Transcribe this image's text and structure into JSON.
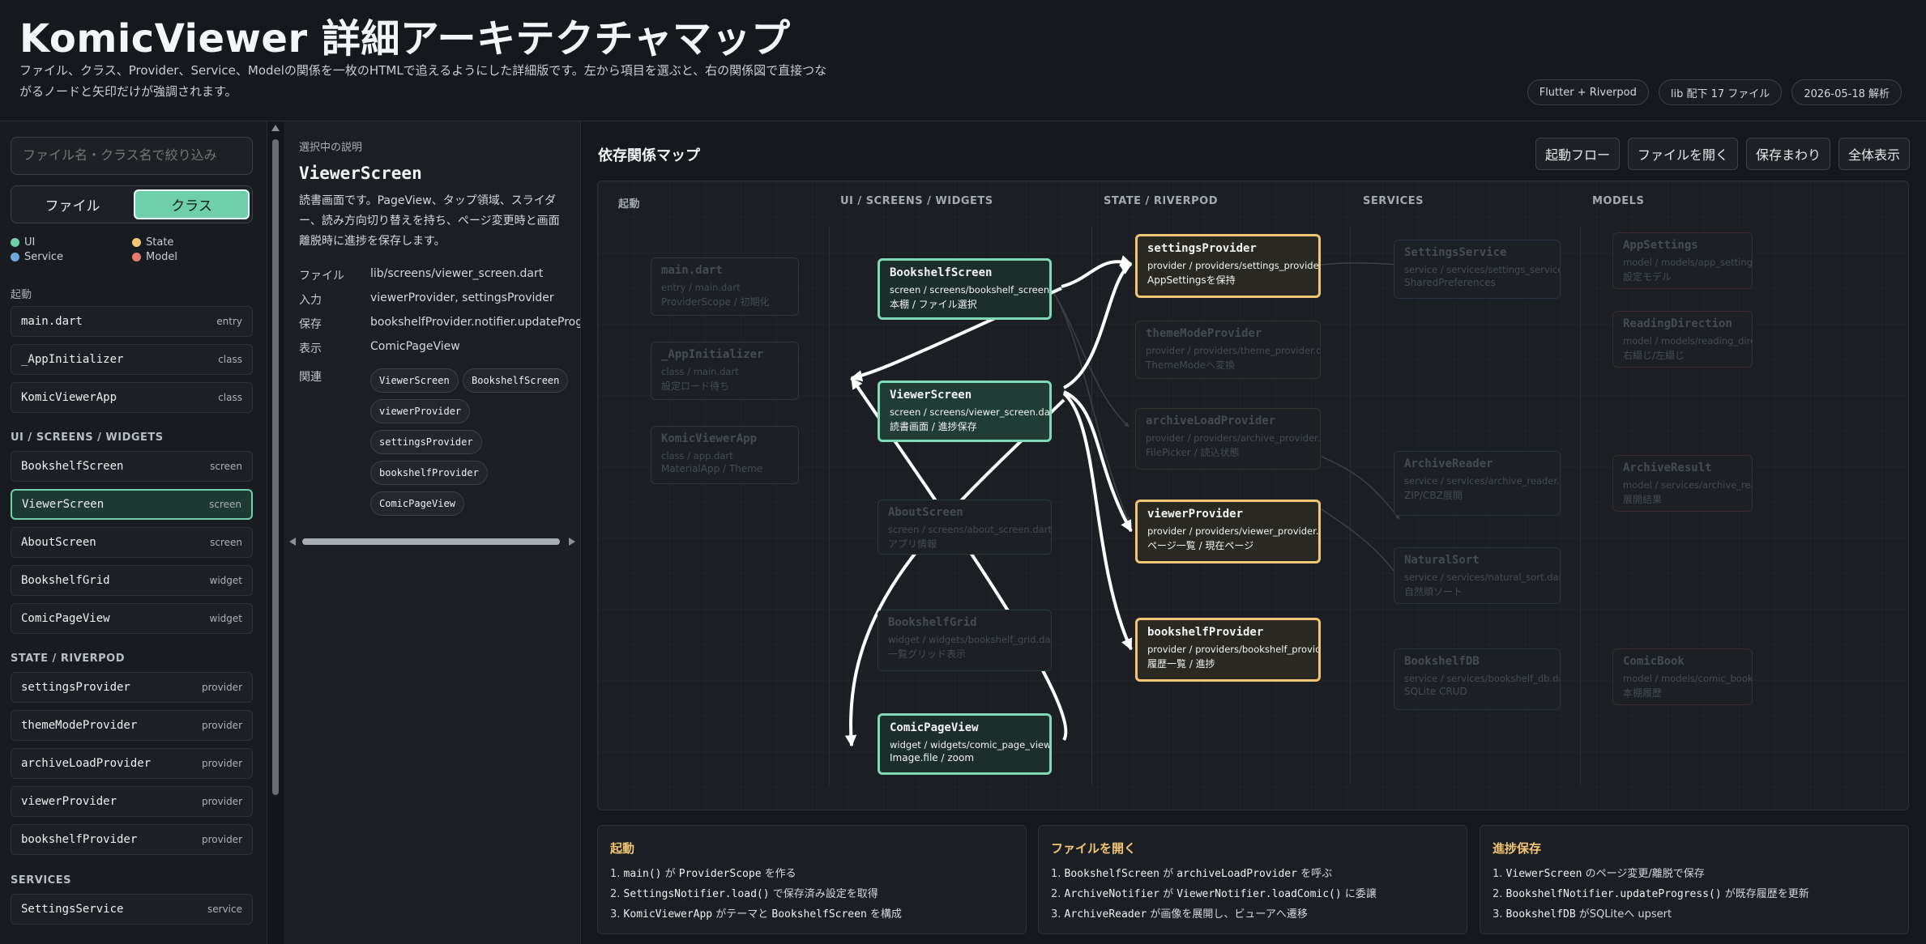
{
  "header": {
    "title": "KomicViewer 詳細アーキテクチャマップ",
    "subtitle": "ファイル、クラス、Provider、Service、Modelの関係を一枚のHTMLで追えるようにした詳細版です。左から項目を選ぶと、右の関係図で直接つながるノードと矢印だけが強調されます。",
    "pills": [
      "Flutter + Riverpod",
      "lib 配下 17 ファイル",
      "2026-05-18 解析"
    ]
  },
  "sidebar": {
    "filter_placeholder": "ファイル名・クラス名で絞り込み",
    "toggle": [
      "ファイル",
      "クラス"
    ],
    "legend": [
      {
        "label": "UI",
        "color": "#6fcfaa"
      },
      {
        "label": "State",
        "color": "#f0c674"
      },
      {
        "label": "Service",
        "color": "#6fa8dc"
      },
      {
        "label": "Model",
        "color": "#e8796f"
      }
    ],
    "sections": [
      {
        "label": "起動",
        "items": [
          {
            "name": "main.dart",
            "tag": "entry"
          },
          {
            "name": "_AppInitializer",
            "tag": "class"
          },
          {
            "name": "KomicViewerApp",
            "tag": "class"
          }
        ]
      },
      {
        "label": "UI / SCREENS / WIDGETS",
        "items": [
          {
            "name": "BookshelfScreen",
            "tag": "screen"
          },
          {
            "name": "ViewerScreen",
            "tag": "screen"
          },
          {
            "name": "AboutScreen",
            "tag": "screen"
          },
          {
            "name": "BookshelfGrid",
            "tag": "widget"
          },
          {
            "name": "ComicPageView",
            "tag": "widget"
          }
        ]
      },
      {
        "label": "STATE / RIVERPOD",
        "items": [
          {
            "name": "settingsProvider",
            "tag": "provider"
          },
          {
            "name": "themeModeProvider",
            "tag": "provider"
          },
          {
            "name": "archiveLoadProvider",
            "tag": "provider"
          },
          {
            "name": "viewerProvider",
            "tag": "provider"
          },
          {
            "name": "bookshelfProvider",
            "tag": "provider"
          }
        ]
      },
      {
        "label": "SERVICES",
        "items": [
          {
            "name": "SettingsService",
            "tag": "service"
          }
        ]
      }
    ]
  },
  "detail": {
    "caption": "選択中の説明",
    "title": "ViewerScreen",
    "description": "読書画面です。PageView、タップ領域、スライダー、読み方向切り替えを持ち、ページ変更時と画面離脱時に進捗を保存します。",
    "rows": [
      {
        "key": "ファイル",
        "value": "lib/screens/viewer_screen.dart"
      },
      {
        "key": "入力",
        "value": "viewerProvider, settingsProvider"
      },
      {
        "key": "保存",
        "value": "bookshelfProvider.notifier.updateProgress"
      },
      {
        "key": "表示",
        "value": "ComicPageView"
      }
    ],
    "related_label": "関連",
    "related": [
      "ViewerScreen",
      "BookshelfScreen",
      "viewerProvider",
      "settingsProvider",
      "bookshelfProvider",
      "ComicPageView"
    ]
  },
  "map": {
    "title": "依存関係マップ",
    "buttons": [
      "起動フロー",
      "ファイルを開く",
      "保存まわり",
      "全体表示"
    ],
    "columns": [
      "起動",
      "UI / SCREENS / WIDGETS",
      "STATE / RIVERPOD",
      "SERVICES",
      "MODELS"
    ],
    "nodes": {
      "main": {
        "name": "main.dart",
        "path": "entry / main.dart",
        "desc": "ProviderScope / 初期化"
      },
      "appinit": {
        "name": "_AppInitializer",
        "path": "class / main.dart",
        "desc": "設定ロード待ち"
      },
      "komicapp": {
        "name": "KomicViewerApp",
        "path": "class / app.dart",
        "desc": "MaterialApp / Theme"
      },
      "bookshelf": {
        "name": "BookshelfScreen",
        "path": "screen / screens/bookshelf_screen.dart",
        "desc": "本棚 / ファイル選択"
      },
      "viewer": {
        "name": "ViewerScreen",
        "path": "screen / screens/viewer_screen.dart",
        "desc": "読書画面 / 進捗保存"
      },
      "about": {
        "name": "AboutScreen",
        "path": "screen / screens/about_screen.dart",
        "desc": "アプリ情報"
      },
      "grid": {
        "name": "BookshelfGrid",
        "path": "widget / widgets/bookshelf_grid.dart",
        "desc": "一覧グリッド表示"
      },
      "comicpage": {
        "name": "ComicPageView",
        "path": "widget / widgets/comic_page_view.dart",
        "desc": "Image.file / zoom"
      },
      "settingsP": {
        "name": "settingsProvider",
        "path": "provider / providers/settings_provider.dart",
        "desc": "AppSettingsを保持"
      },
      "themeP": {
        "name": "themeModeProvider",
        "path": "provider / providers/theme_provider.dart",
        "desc": "ThemeModeへ変換"
      },
      "archiveP": {
        "name": "archiveLoadProvider",
        "path": "provider / providers/archive_provider.dart",
        "desc": "FilePicker / 読込状態"
      },
      "viewerP": {
        "name": "viewerProvider",
        "path": "provider / providers/viewer_provider.dart",
        "desc": "ページ一覧 / 現在ページ"
      },
      "bookshelfP": {
        "name": "bookshelfProvider",
        "path": "provider / providers/bookshelf_provider.dart",
        "desc": "履歴一覧 / 進捗"
      },
      "settingsS": {
        "name": "SettingsService",
        "path": "service / services/settings_service.dart",
        "desc": "SharedPreferences"
      },
      "archiveR": {
        "name": "ArchiveReader",
        "path": "service / services/archive_reader.dart",
        "desc": "ZIP/CBZ展開"
      },
      "naturalS": {
        "name": "NaturalSort",
        "path": "service / services/natural_sort.dart",
        "desc": "自然順ソート"
      },
      "bookshelfDB": {
        "name": "BookshelfDB",
        "path": "service / services/bookshelf_db.dart",
        "desc": "SQLite CRUD"
      },
      "appSettings": {
        "name": "AppSettings",
        "path": "model / models/app_settings.dart",
        "desc": "設定モデル"
      },
      "readingDir": {
        "name": "ReadingDirection",
        "path": "model / models/reading_direction.dart",
        "desc": "右綴じ/左綴じ"
      },
      "archiveRes": {
        "name": "ArchiveResult",
        "path": "model / services/archive_reader.dart",
        "desc": "展開結果"
      },
      "comicBook": {
        "name": "ComicBook",
        "path": "model / models/comic_book.dart",
        "desc": "本棚履歴"
      }
    }
  },
  "cards": [
    {
      "title": "起動",
      "steps": [
        [
          {
            "c": "main()"
          },
          {
            "t": " が "
          },
          {
            "c": "ProviderScope"
          },
          {
            "t": " を作る"
          }
        ],
        [
          {
            "c": "SettingsNotifier.load()"
          },
          {
            "t": " で保存済み設定を取得"
          }
        ],
        [
          {
            "c": "KomicViewerApp"
          },
          {
            "t": " がテーマと "
          },
          {
            "c": "BookshelfScreen"
          },
          {
            "t": " を構成"
          }
        ]
      ]
    },
    {
      "title": "ファイルを開く",
      "steps": [
        [
          {
            "c": "BookshelfScreen"
          },
          {
            "t": " が "
          },
          {
            "c": "archiveLoadProvider"
          },
          {
            "t": " を呼ぶ"
          }
        ],
        [
          {
            "c": "ArchiveNotifier"
          },
          {
            "t": " が "
          },
          {
            "c": "ViewerNotifier.loadComic()"
          },
          {
            "t": " に委譲"
          }
        ],
        [
          {
            "c": "ArchiveReader"
          },
          {
            "t": " が画像を展開し、ビューアへ遷移"
          }
        ]
      ]
    },
    {
      "title": "進捗保存",
      "steps": [
        [
          {
            "c": "ViewerScreen"
          },
          {
            "t": " のページ変更/離脱で保存"
          }
        ],
        [
          {
            "c": "BookshelfNotifier.updateProgress()"
          },
          {
            "t": " が既存履歴を更新"
          }
        ],
        [
          {
            "c": "BookshelfDB"
          },
          {
            "t": " がSQLiteへ upsert"
          }
        ]
      ]
    }
  ]
}
